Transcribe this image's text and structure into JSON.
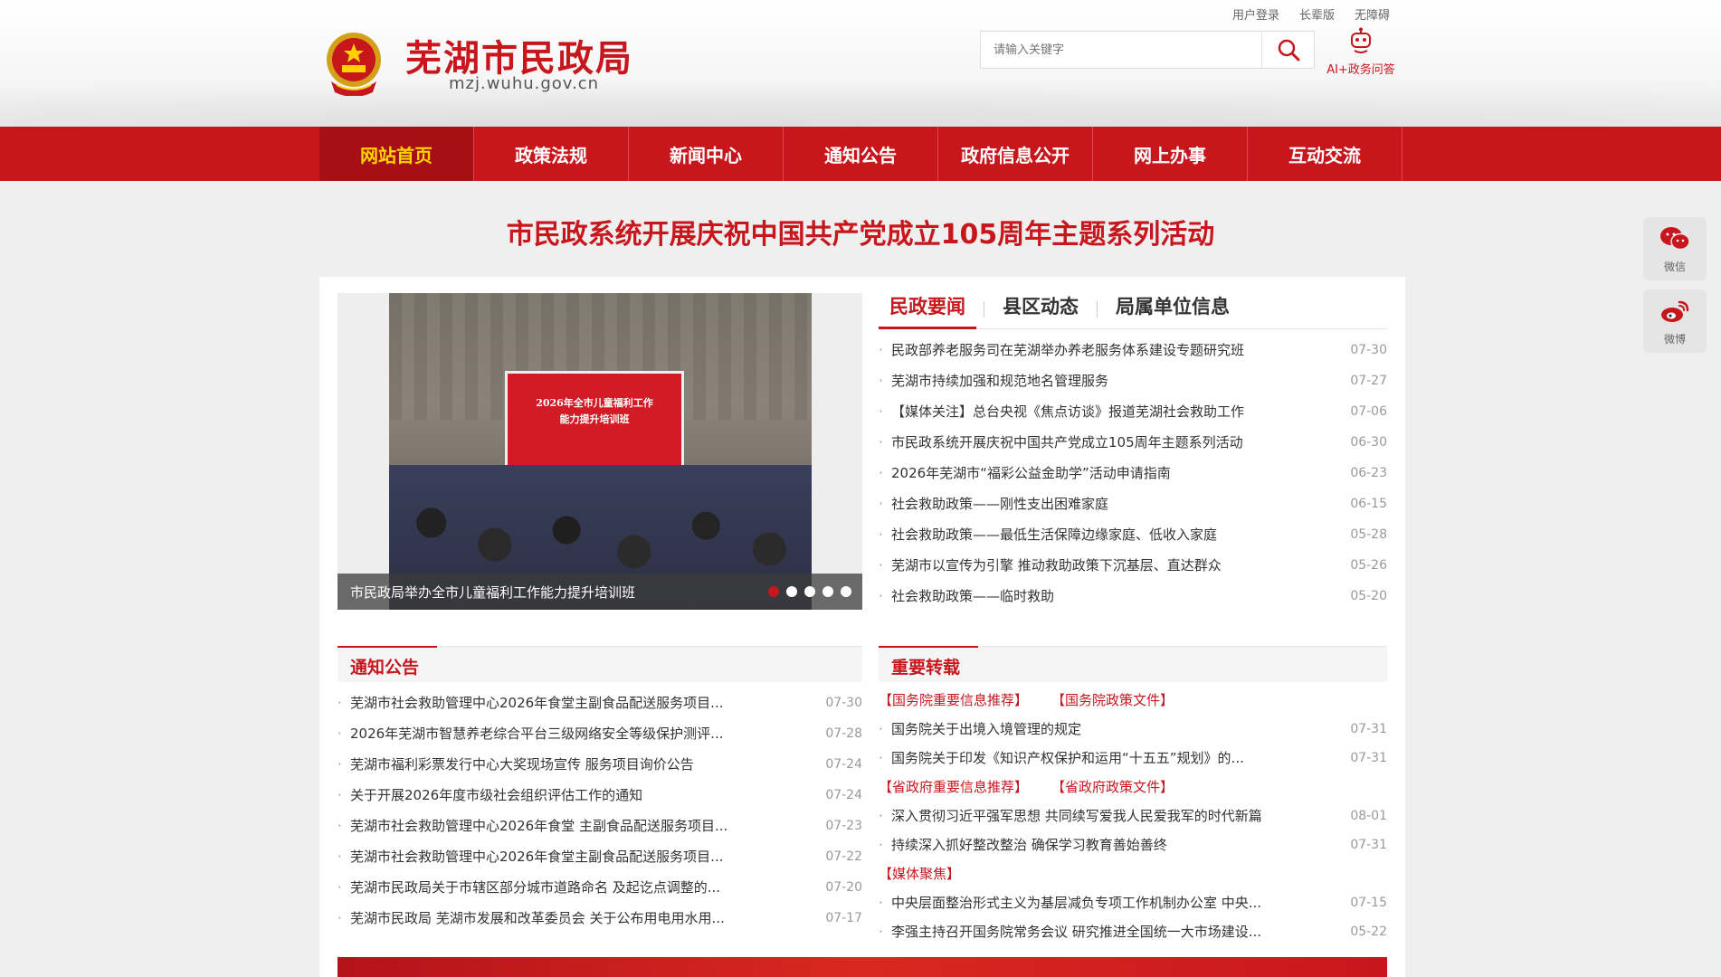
{
  "header": {
    "top_links": [
      "用户登录",
      "长辈版",
      "无障碍"
    ],
    "site_title": "芜湖市民政局",
    "site_domain": "mzj.wuhu.gov.cn",
    "search_placeholder": "请输入关键字",
    "ai_label": "AI+政务问答"
  },
  "nav": {
    "items": [
      "网站首页",
      "政策法规",
      "新闻中心",
      "通知公告",
      "政府信息公开",
      "网上办事",
      "互动交流"
    ],
    "active_index": 0
  },
  "headline": "市民政系统开展庆祝中国共产党成立105周年主题系列活动",
  "side": {
    "wechat": "微信",
    "weibo": "微博"
  },
  "carousel": {
    "caption": "市民政局举办全市儿童福利工作能力提升培训班",
    "screen_text_1": "2026年全市儿童福利工作",
    "screen_text_2": "能力提升培训班",
    "dots": 5,
    "active_dot": 0
  },
  "news": {
    "tabs": [
      "民政要闻",
      "县区动态",
      "局属单位信息"
    ],
    "items": [
      {
        "title": "民政部养老服务司在芜湖举办养老服务体系建设专题研究班",
        "date": "07-30"
      },
      {
        "title": "芜湖市持续加强和规范地名管理服务",
        "date": "07-27"
      },
      {
        "title": "【媒体关注】总台央视《焦点访谈》报道芜湖社会救助工作",
        "date": "07-06"
      },
      {
        "title": "市民政系统开展庆祝中国共产党成立105周年主题系列活动",
        "date": "06-30"
      },
      {
        "title": "2026年芜湖市“福彩公益金助学”活动申请指南",
        "date": "06-23"
      },
      {
        "title": "社会救助政策——刚性支出困难家庭",
        "date": "06-15"
      },
      {
        "title": "社会救助政策——最低生活保障边缘家庭、低收入家庭",
        "date": "05-28"
      },
      {
        "title": "芜湖市以宣传为引擎 推动救助政策下沉基层、直达群众",
        "date": "05-26"
      },
      {
        "title": "社会救助政策——临时救助",
        "date": "05-20"
      }
    ]
  },
  "notices": {
    "heading": "通知公告",
    "items": [
      {
        "title": "芜湖市社会救助管理中心2026年食堂主副食品配送服务项目...",
        "date": "07-30"
      },
      {
        "title": "2026年芜湖市智慧养老综合平台三级网络安全等级保护测评...",
        "date": "07-28"
      },
      {
        "title": "芜湖市福利彩票发行中心大奖现场宣传 服务项目询价公告",
        "date": "07-24"
      },
      {
        "title": "关于开展2026年度市级社会组织评估工作的通知",
        "date": "07-24"
      },
      {
        "title": "芜湖市社会救助管理中心2026年食堂 主副食品配送服务项目...",
        "date": "07-23"
      },
      {
        "title": "芜湖市社会救助管理中心2026年食堂主副食品配送服务项目...",
        "date": "07-22"
      },
      {
        "title": "芜湖市民政局关于市辖区部分城市道路命名 及起讫点调整的...",
        "date": "07-20"
      },
      {
        "title": "芜湖市民政局 芜湖市发展和改革委员会 关于公布用电用水用...",
        "date": "07-17"
      }
    ]
  },
  "reprints": {
    "heading": "重要转载",
    "cat1": [
      "【国务院重要信息推荐】",
      "【国务院政策文件】"
    ],
    "group1": [
      {
        "title": "国务院关于出境入境管理的规定",
        "date": "07-31"
      },
      {
        "title": "国务院关于印发《知识产权保护和运用“十五五”规划》的...",
        "date": "07-31"
      }
    ],
    "cat2": [
      "【省政府重要信息推荐】",
      "【省政府政策文件】"
    ],
    "group2": [
      {
        "title": "深入贯彻习近平强军思想 共同续写爱我人民爱我军的时代新篇",
        "date": "08-01"
      },
      {
        "title": "持续深入抓好整改整治 确保学习教育善始善终",
        "date": "07-31"
      }
    ],
    "cat3": [
      "【媒体聚焦】"
    ],
    "group3": [
      {
        "title": "中央层面整治形式主义为基层减负专项工作机制办公室 中央...",
        "date": "07-15"
      },
      {
        "title": "李强主持召开国务院常务会议 研究推进全国统一大市场建设...",
        "date": "05-22"
      }
    ]
  },
  "colors": {
    "brand_red": "#c8161d",
    "nav_active_text": "#ffd200"
  }
}
